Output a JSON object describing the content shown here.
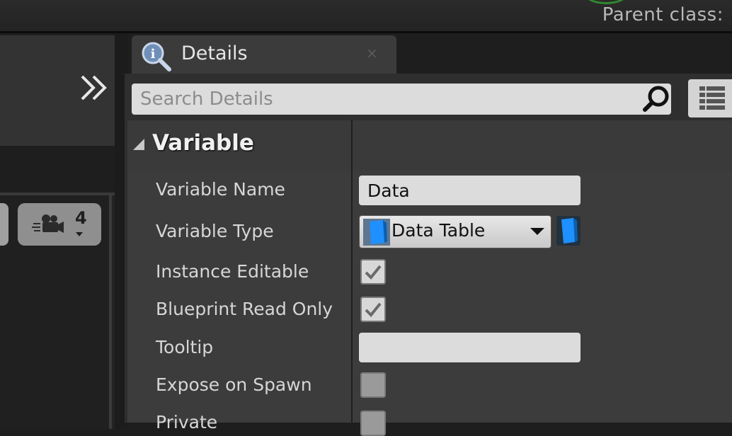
{
  "header": {
    "parent_class_label": "Parent class:"
  },
  "left_toolbar": {
    "camera_speed": "4"
  },
  "details_panel": {
    "tab_title": "Details",
    "close_glyph": "×",
    "search": {
      "placeholder": "Search Details",
      "value": ""
    },
    "section": {
      "title": "Variable",
      "rows": [
        {
          "label": "Variable Name",
          "kind": "text",
          "value": "Data"
        },
        {
          "label": "Variable Type",
          "kind": "type-select",
          "value": "Data Table"
        },
        {
          "label": "Instance Editable",
          "kind": "checkbox",
          "checked": true
        },
        {
          "label": "Blueprint Read Only",
          "kind": "checkbox",
          "checked": true
        },
        {
          "label": "Tooltip",
          "kind": "text",
          "value": ""
        },
        {
          "label": "Expose on Spawn",
          "kind": "checkbox",
          "checked": false
        },
        {
          "label": "Private",
          "kind": "checkbox",
          "checked": false
        }
      ]
    }
  },
  "colors": {
    "pin_blue": "#1e90ff",
    "accent_green": "#2f8a2f"
  },
  "icons": [
    "expand-chevrons-icon",
    "camera-icon",
    "details-magnifier-icon",
    "search-icon",
    "view-options-icon",
    "type-pin-icon",
    "container-type-icon",
    "checkmark-icon"
  ]
}
